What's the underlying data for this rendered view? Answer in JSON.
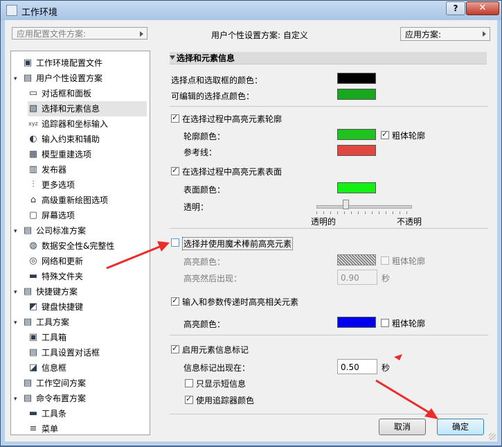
{
  "window": {
    "title": "工作环境",
    "help_label": "?",
    "close_label": "✕"
  },
  "topbar": {
    "profile_scheme_placeholder": "应用配置文件方案:",
    "user_scheme_text": "用户个性设置方案:  自定义",
    "apply_scheme_label": "应用方案:"
  },
  "tree": {
    "items": [
      {
        "label": "工作环境配置文件",
        "icon": "profile-icon"
      },
      {
        "label": "用户个性设置方案",
        "icon": "user-scheme-icon",
        "expand": "▾"
      },
      {
        "label": "对话框和面板",
        "icon": "dialog-panel-icon"
      },
      {
        "label": "选择和元素信息",
        "icon": "selection-info-icon"
      },
      {
        "label": "追踪器和坐标输入",
        "icon": "xyz-icon"
      },
      {
        "label": "输入约束和辅助",
        "icon": "mouse-icon"
      },
      {
        "label": "模型重建选项",
        "icon": "model-icon"
      },
      {
        "label": "发布器",
        "icon": "publisher-icon"
      },
      {
        "label": "更多选项",
        "icon": "options-icon"
      },
      {
        "label": "高级重新绘图选项",
        "icon": "redraw-icon"
      },
      {
        "label": "屏幕选项",
        "icon": "screen-icon"
      },
      {
        "label": "公司标准方案",
        "icon": "company-scheme-icon",
        "expand": "▾"
      },
      {
        "label": "数据安全性&完整性",
        "icon": "data-safety-icon"
      },
      {
        "label": "网络和更新",
        "icon": "globe-icon"
      },
      {
        "label": "特殊文件夹",
        "icon": "folder-icon"
      },
      {
        "label": "快捷键方案",
        "icon": "shortcut-scheme-icon",
        "expand": "▾"
      },
      {
        "label": "键盘快捷键",
        "icon": "keyboard-icon"
      },
      {
        "label": "工具方案",
        "icon": "tool-scheme-icon",
        "expand": "▾"
      },
      {
        "label": "工具箱",
        "icon": "toolbox-icon"
      },
      {
        "label": "工具设置对话框",
        "icon": "tool-settings-icon"
      },
      {
        "label": "信息框",
        "icon": "info-box-icon"
      },
      {
        "label": "工作空间方案",
        "icon": "workspace-icon"
      },
      {
        "label": "命令布置方案",
        "icon": "command-scheme-icon",
        "expand": "▾"
      },
      {
        "label": "工具条",
        "icon": "toolbar-icon"
      },
      {
        "label": "菜单",
        "icon": "menu-icon"
      }
    ]
  },
  "panel": {
    "section_title": "选择和元素信息",
    "sel_point_color_label": "选择点和选取框的颜色：",
    "edit_point_color_label": "可编辑的选择点颜色：",
    "hl_outline_label": "在选择过程中高亮元素轮廓",
    "outline_color_label": "轮廓颜色：",
    "bold_outline_label": "粗体轮廓",
    "reference_line_label": "参考线：",
    "hl_surface_label": "在选择过程中高亮元素表面",
    "surface_color_label": "表面颜色：",
    "transparency_label": "透明：",
    "transparent_label": "透明的",
    "opaque_label": "不透明",
    "magic_wand_label": "选择并使用魔术棒前高亮元素",
    "hl_color_label": "高亮颜色：",
    "bold_outline_label2": "粗体轮廓",
    "hl_delay_label": "高亮然后出现：",
    "hl_delay_value": "0.90",
    "seconds_label": "秒",
    "param_hl_label": "输入和参数传递时高亮相关元素",
    "hl_color_label2": "高亮颜色：",
    "bold_outline_label3": "粗体轮廓",
    "info_tag_label": "启用元素信息标记",
    "info_tag_delay_label": "信息标记出现在：",
    "info_tag_delay_value": "0.50",
    "seconds_label2": "秒",
    "short_info_label": "只显示短信息",
    "tracker_color_label": "使用追踪器颜色",
    "colors": {
      "sel_point": "#000000",
      "edit_point": "#17a81f",
      "outline": "#1fc21f",
      "reference_line": "#e0483f",
      "surface": "#14f014",
      "param_hl": "#0000ee"
    },
    "checks": {
      "hl_outline": true,
      "bold_outline": true,
      "hl_surface": true,
      "magic_wand": false,
      "param_hl": true,
      "bold_outline3": false,
      "info_tag": true,
      "short_info": false,
      "tracker_color": true
    },
    "transparency_level": 0.3
  },
  "buttons": {
    "cancel_label": "取消",
    "ok_label": "确定"
  }
}
